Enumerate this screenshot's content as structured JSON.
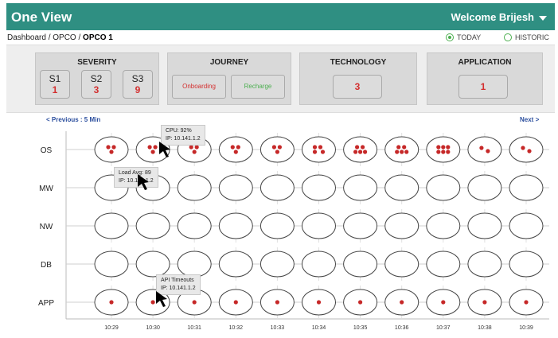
{
  "header": {
    "app_title": "One View",
    "welcome": "Welcome Brijesh"
  },
  "breadcrumb": {
    "path": "Dashboard / OPCO / ",
    "current": "OPCO 1"
  },
  "mode": {
    "today": "TODAY",
    "historic": "HISTORIC",
    "selected": "today"
  },
  "filters": {
    "severity": {
      "title": "SEVERITY",
      "items": [
        {
          "label": "S1",
          "value": "1"
        },
        {
          "label": "S2",
          "value": "3"
        },
        {
          "label": "S3",
          "value": "9"
        }
      ]
    },
    "journey": {
      "title": "JOURNEY",
      "onboarding": "Onboarding",
      "recharge": "Recharge"
    },
    "technology": {
      "title": "TECHNOLOGY",
      "value": "3"
    },
    "application": {
      "title": "APPLICATION",
      "value": "1"
    }
  },
  "nav": {
    "previous": "< Previous : 5 Min",
    "next": "Next >"
  },
  "grid": {
    "rows": [
      "OS",
      "MW",
      "NW",
      "DB",
      "APP"
    ],
    "times": [
      "10:29",
      "10:30",
      "10:31",
      "10:32",
      "10:33",
      "10:34",
      "10:35",
      "10:36",
      "10:37",
      "10:38",
      "10:39"
    ],
    "dot_counts": {
      "OS": [
        3,
        3,
        3,
        3,
        3,
        4,
        5,
        5,
        6,
        2,
        2
      ],
      "MW": [
        0,
        0,
        0,
        0,
        0,
        0,
        0,
        0,
        0,
        0,
        0
      ],
      "NW": [
        0,
        0,
        0,
        0,
        0,
        0,
        0,
        0,
        0,
        0,
        0
      ],
      "DB": [
        0,
        0,
        0,
        0,
        0,
        0,
        0,
        0,
        0,
        0,
        0
      ],
      "APP": [
        1,
        1,
        1,
        1,
        1,
        1,
        1,
        1,
        1,
        1,
        1
      ]
    },
    "dot_color": "#c62828"
  },
  "tooltips": [
    {
      "line1": "CPU: 92%",
      "line2": "IP: 10.141.1.2"
    },
    {
      "line1": "Load Avg: 89",
      "line2": "IP: 10.141.1.2"
    },
    {
      "line1": "API Timeouts",
      "line2": "IP: 10.141.1.2"
    }
  ],
  "colors": {
    "header": "#2f8f82",
    "value_red": "#d32f2f",
    "recharge_green": "#4caf50",
    "link_blue": "#2c4f9e"
  }
}
